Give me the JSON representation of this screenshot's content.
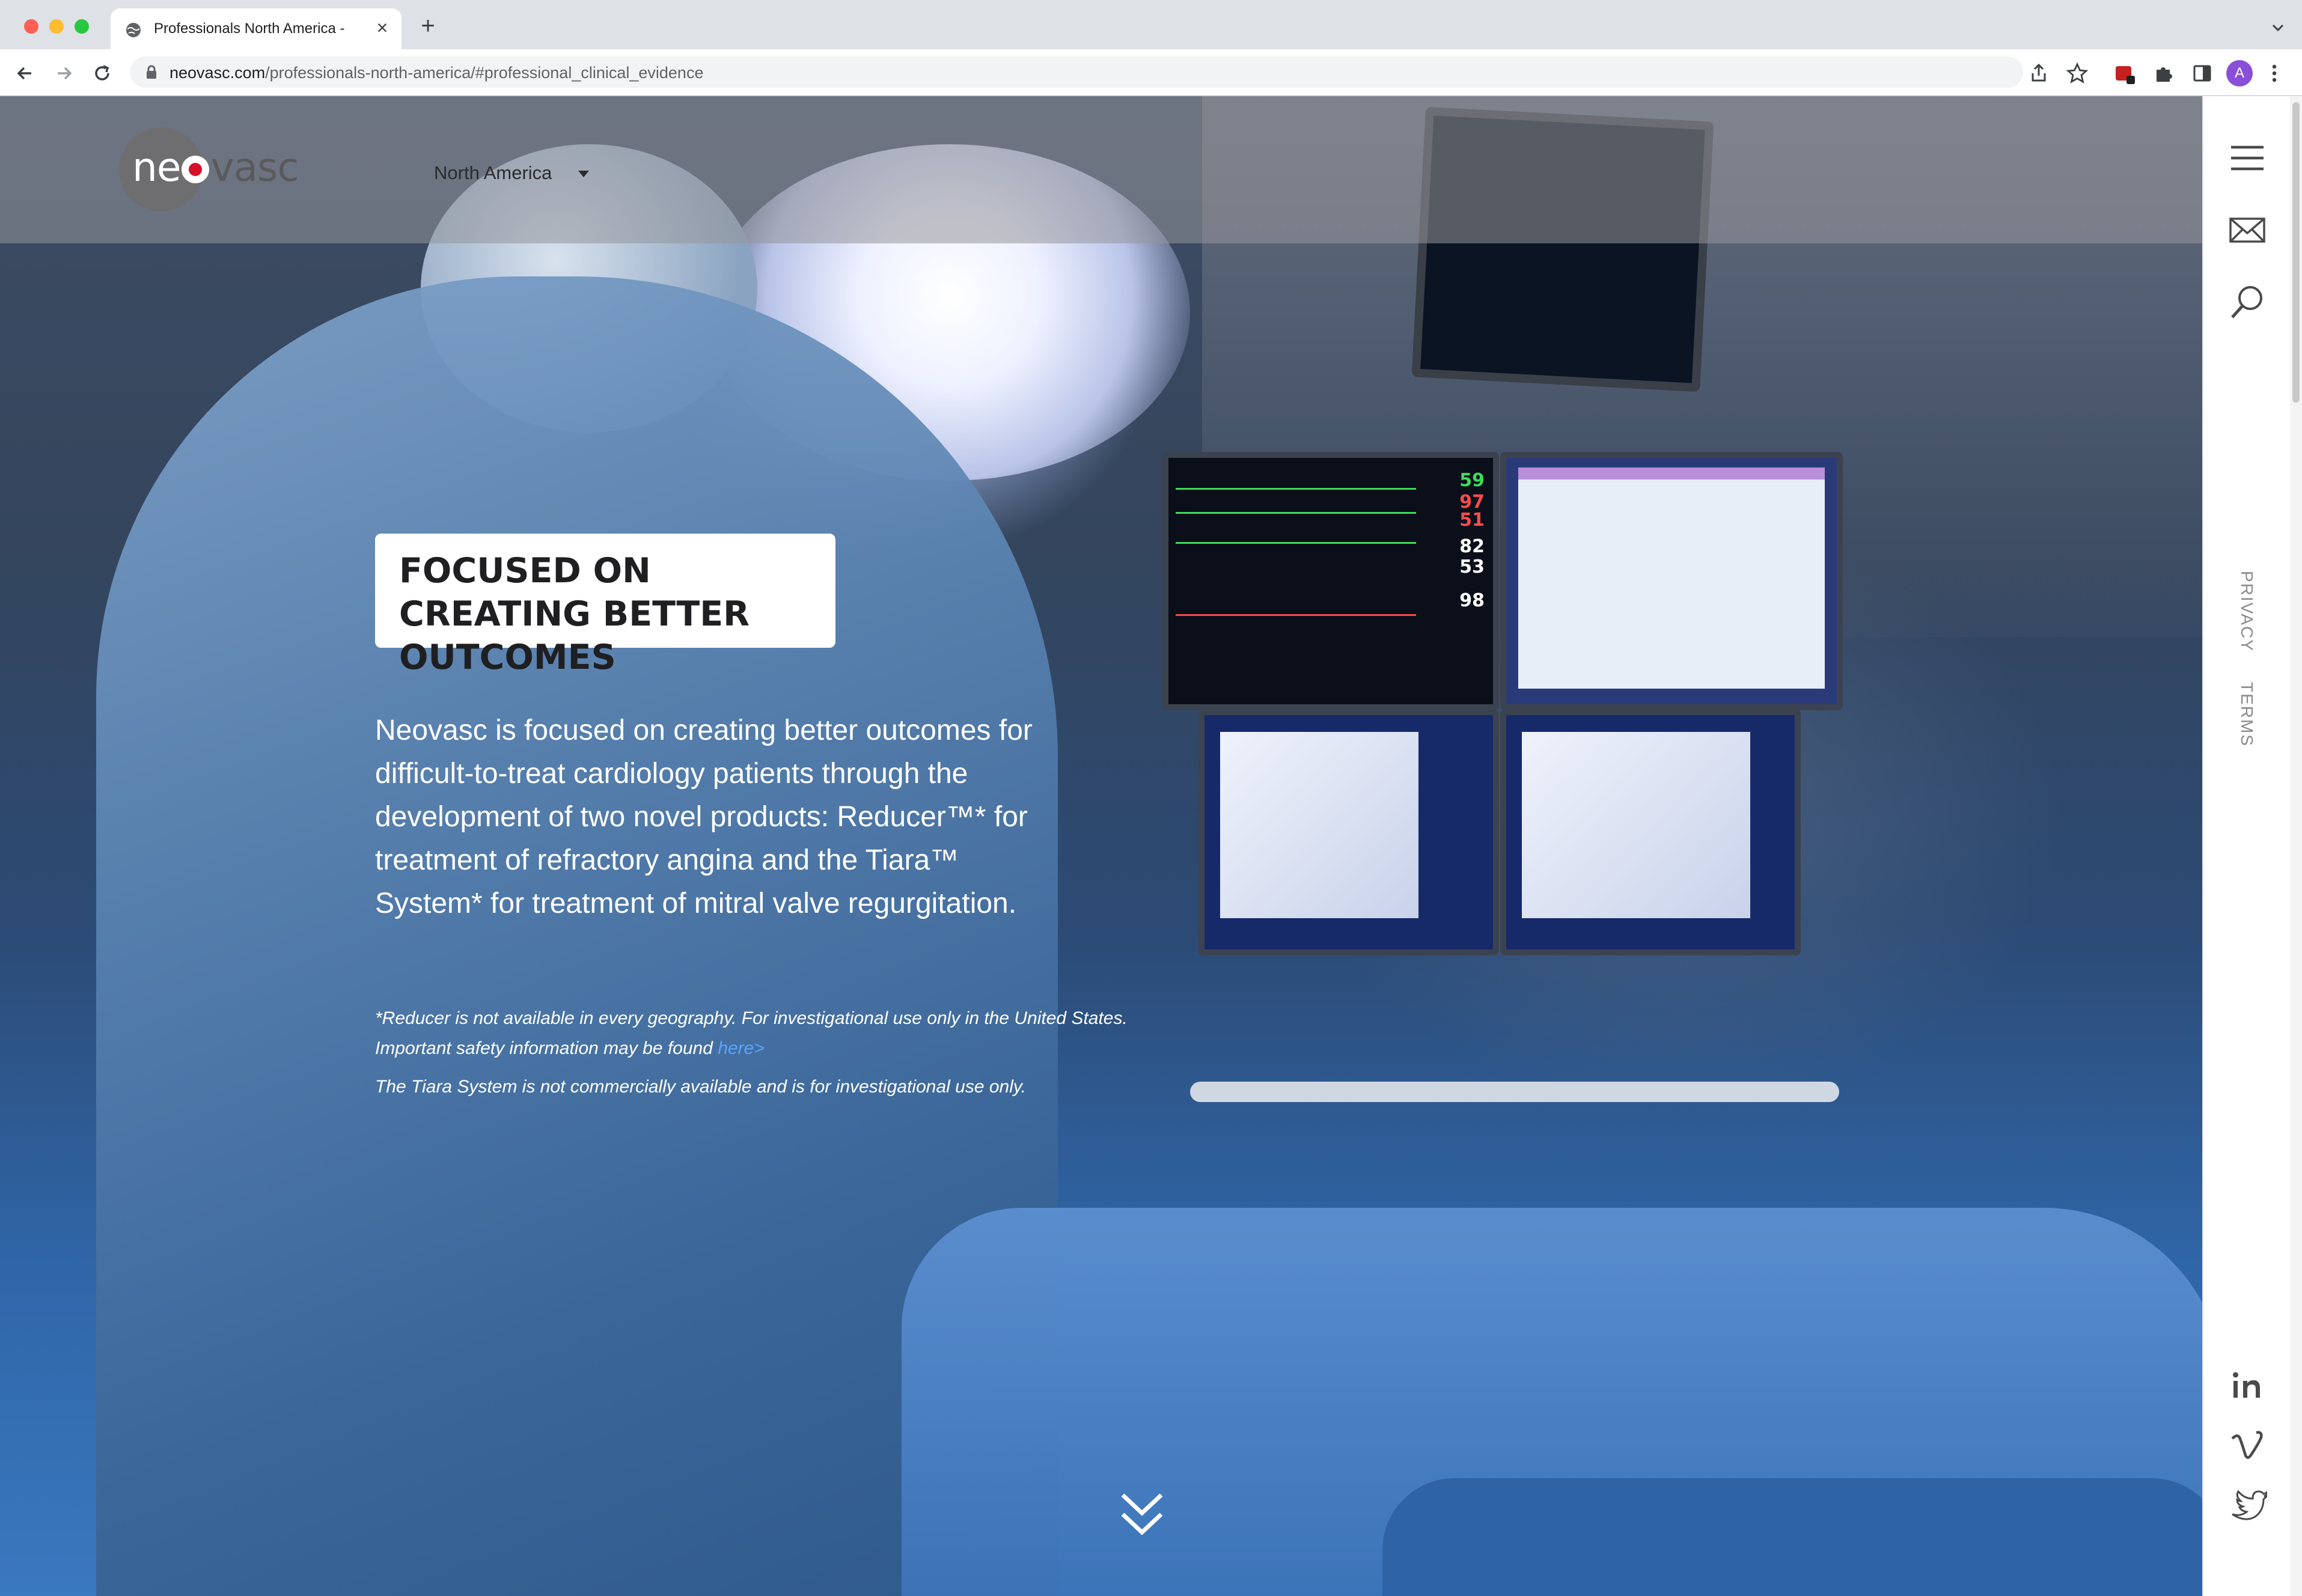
{
  "browser": {
    "tab_title": "Professionals North America -",
    "tab_close": "×",
    "new_tab": "+",
    "url_host": "neovasc.com",
    "url_path": "/professionals-north-america/#professional_clinical_evidence",
    "profile_initial": "A"
  },
  "header": {
    "logo": {
      "part1": "ne",
      "part2": "vasc"
    },
    "region": "North America"
  },
  "hero": {
    "headline": "FOCUSED ON CREATING BETTER OUTCOMES",
    "intro": "Neovasc is focused on creating better outcomes for difficult-to-treat cardiology patients through the development of two novel products: Reducer™* for treatment of refractory angina and the Tiara™ System* for treatment of mitral valve regurgitation.",
    "disclaimer_line1": "*Reducer is not available in every geography. For investigational use only in the United States.",
    "disclaimer_line2": "Important safety information may be found",
    "disclaimer_link": "here>",
    "disclaimer_line3": "The Tiara System is not commercially available and is for investigational use only.",
    "vitals": [
      "59",
      "97",
      "51",
      "82",
      "53",
      "98"
    ]
  },
  "rail": {
    "privacy": "PRIVACY",
    "terms": "TERMS"
  },
  "colors": {
    "accent_red": "#d4102a",
    "link_blue": "#59a3ff",
    "rail_text": "#8a8a8c"
  },
  "icons": [
    "globe-icon",
    "back-icon",
    "forward-icon",
    "reload-icon",
    "lock-icon",
    "share-icon",
    "star-icon",
    "extension-icon",
    "puzzle-icon",
    "sidepanel-icon",
    "menu-icon",
    "mail-icon",
    "search-icon",
    "linkedin-icon",
    "vimeo-icon",
    "twitter-icon",
    "chevron-down-double-icon"
  ]
}
